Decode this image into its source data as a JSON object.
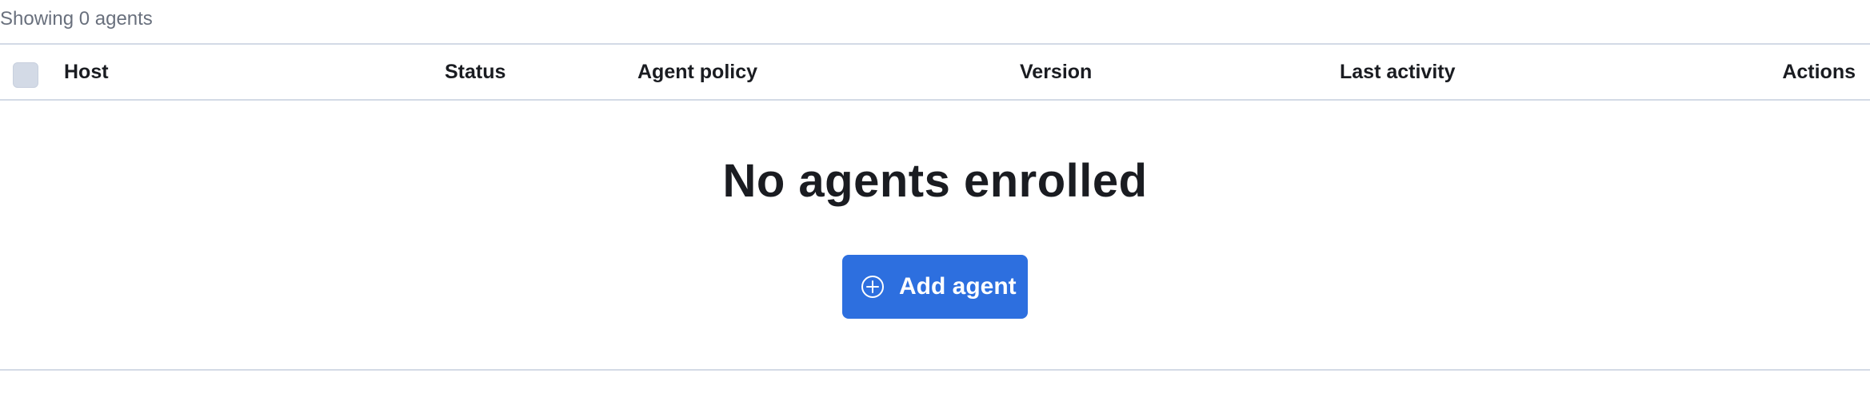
{
  "summary": {
    "text": "Showing 0 agents"
  },
  "table": {
    "columns": [
      "Host",
      "Status",
      "Agent policy",
      "Version",
      "Last activity",
      "Actions"
    ]
  },
  "empty_state": {
    "title": "No agents enrolled",
    "button_label": "Add agent",
    "button_icon": "plus-circle-icon"
  },
  "colors": {
    "accent": "#2d6fdf",
    "text": "#1a1c21",
    "muted_text": "#69707d",
    "border": "#d3dae6"
  }
}
